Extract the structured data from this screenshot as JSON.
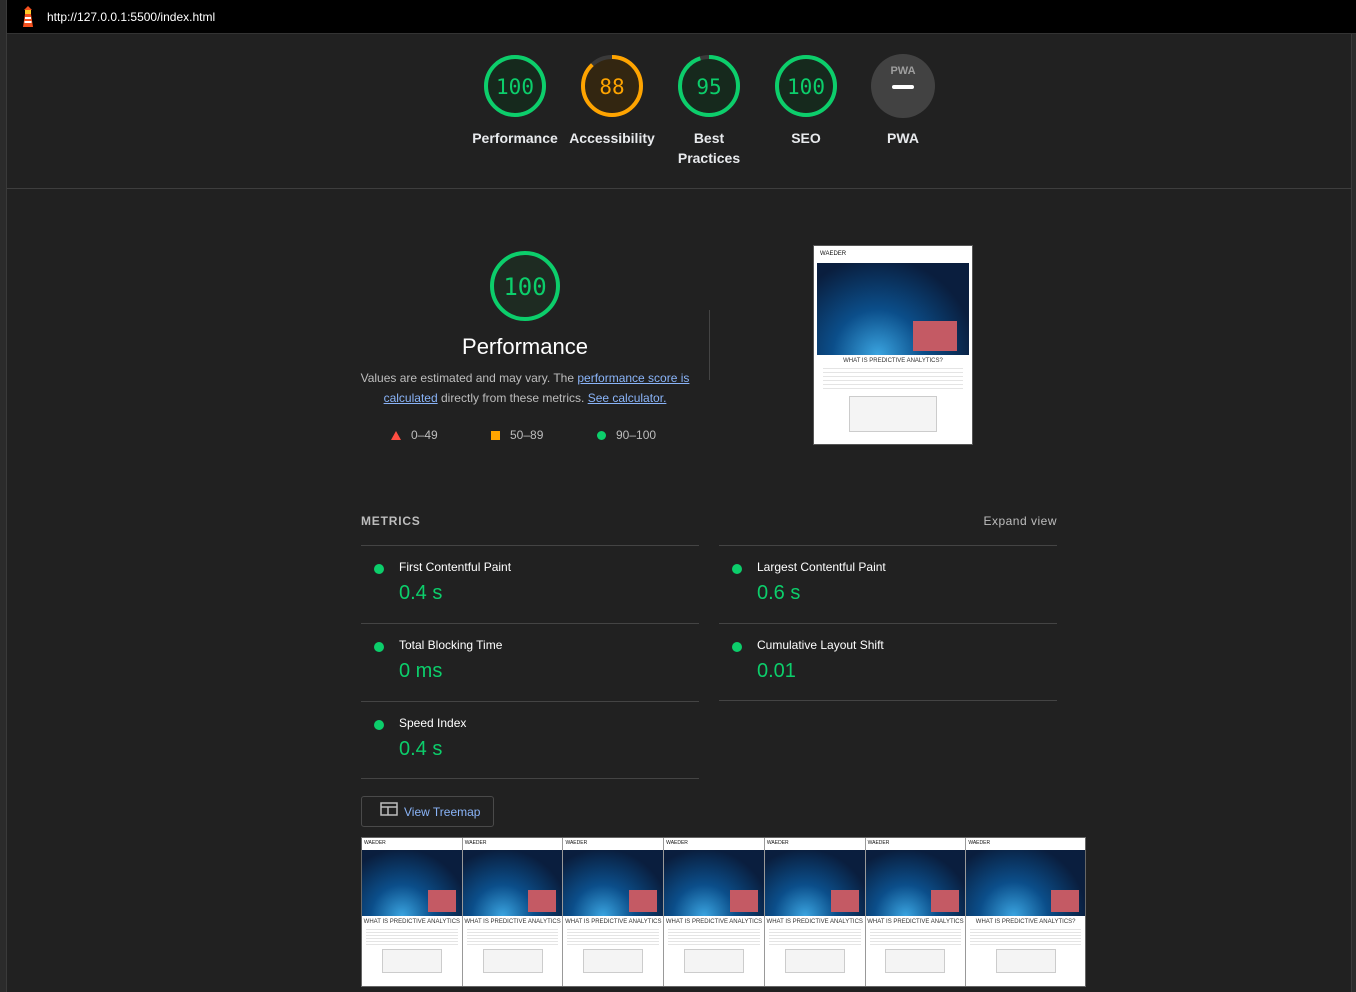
{
  "browser": {
    "url": "http://127.0.0.1:5500/index.html",
    "logo_icon": "lighthouse-icon"
  },
  "summary": {
    "gauges": [
      {
        "label": "Performance",
        "score": "100",
        "fraction": 1.0,
        "color": "#0cce6b"
      },
      {
        "label": "Accessibility",
        "score": "88",
        "fraction": 0.88,
        "color": "#ffa400"
      },
      {
        "label": "Best Practices",
        "score": "95",
        "fraction": 0.95,
        "color": "#0cce6b"
      },
      {
        "label": "SEO",
        "score": "100",
        "fraction": 1.0,
        "color": "#0cce6b"
      },
      {
        "label": "PWA",
        "score": "",
        "fraction": 0,
        "color": "#9e9e9e",
        "badge": "PWA"
      }
    ]
  },
  "performance": {
    "score": "100",
    "title": "Performance",
    "desc_prefix": "Values are estimated and may vary. The ",
    "desc_link1": "performance score is calculated",
    "desc_middle": " directly from these metrics. ",
    "desc_link2": "See calculator.",
    "legend": [
      {
        "range": "0–49",
        "shape": "triangle",
        "color": "#ff4e42"
      },
      {
        "range": "50–89",
        "shape": "square",
        "color": "#ffa400"
      },
      {
        "range": "90–100",
        "shape": "circle",
        "color": "#0cce6b"
      }
    ]
  },
  "screenshot": {
    "brand": "WAEDER",
    "heading": "WHAT IS PREDICTIVE ANALYTICS?"
  },
  "metrics": {
    "title": "METRICS",
    "expand_label": "Expand view",
    "items": [
      {
        "name": "First Contentful Paint",
        "value": "0.4 s"
      },
      {
        "name": "Largest Contentful Paint",
        "value": "0.6 s"
      },
      {
        "name": "Total Blocking Time",
        "value": "0 ms"
      },
      {
        "name": "Cumulative Layout Shift",
        "value": "0.01"
      },
      {
        "name": "Speed Index",
        "value": "0.4 s"
      }
    ]
  },
  "treemap": {
    "label": "View Treemap",
    "icon": "treemap-icon"
  },
  "filmstrip": {
    "frames": [
      {
        "brand": "WAEDER",
        "title": "WHAT IS PREDICTIVE ANALYTICS"
      },
      {
        "brand": "WAEDER",
        "title": "WHAT IS PREDICTIVE ANALYTICS"
      },
      {
        "brand": "WAEDER",
        "title": "WHAT IS PREDICTIVE ANALYTICS"
      },
      {
        "brand": "WAEDER",
        "title": "WHAT IS PREDICTIVE ANALYTICS"
      },
      {
        "brand": "WAEDER",
        "title": "WHAT IS PREDICTIVE ANALYTICS"
      },
      {
        "brand": "WAEDER",
        "title": "WHAT IS PREDICTIVE ANALYTICS"
      },
      {
        "brand": "WAEDER",
        "title": "WHAT IS PREDICTIVE ANALYTICS?"
      }
    ]
  }
}
